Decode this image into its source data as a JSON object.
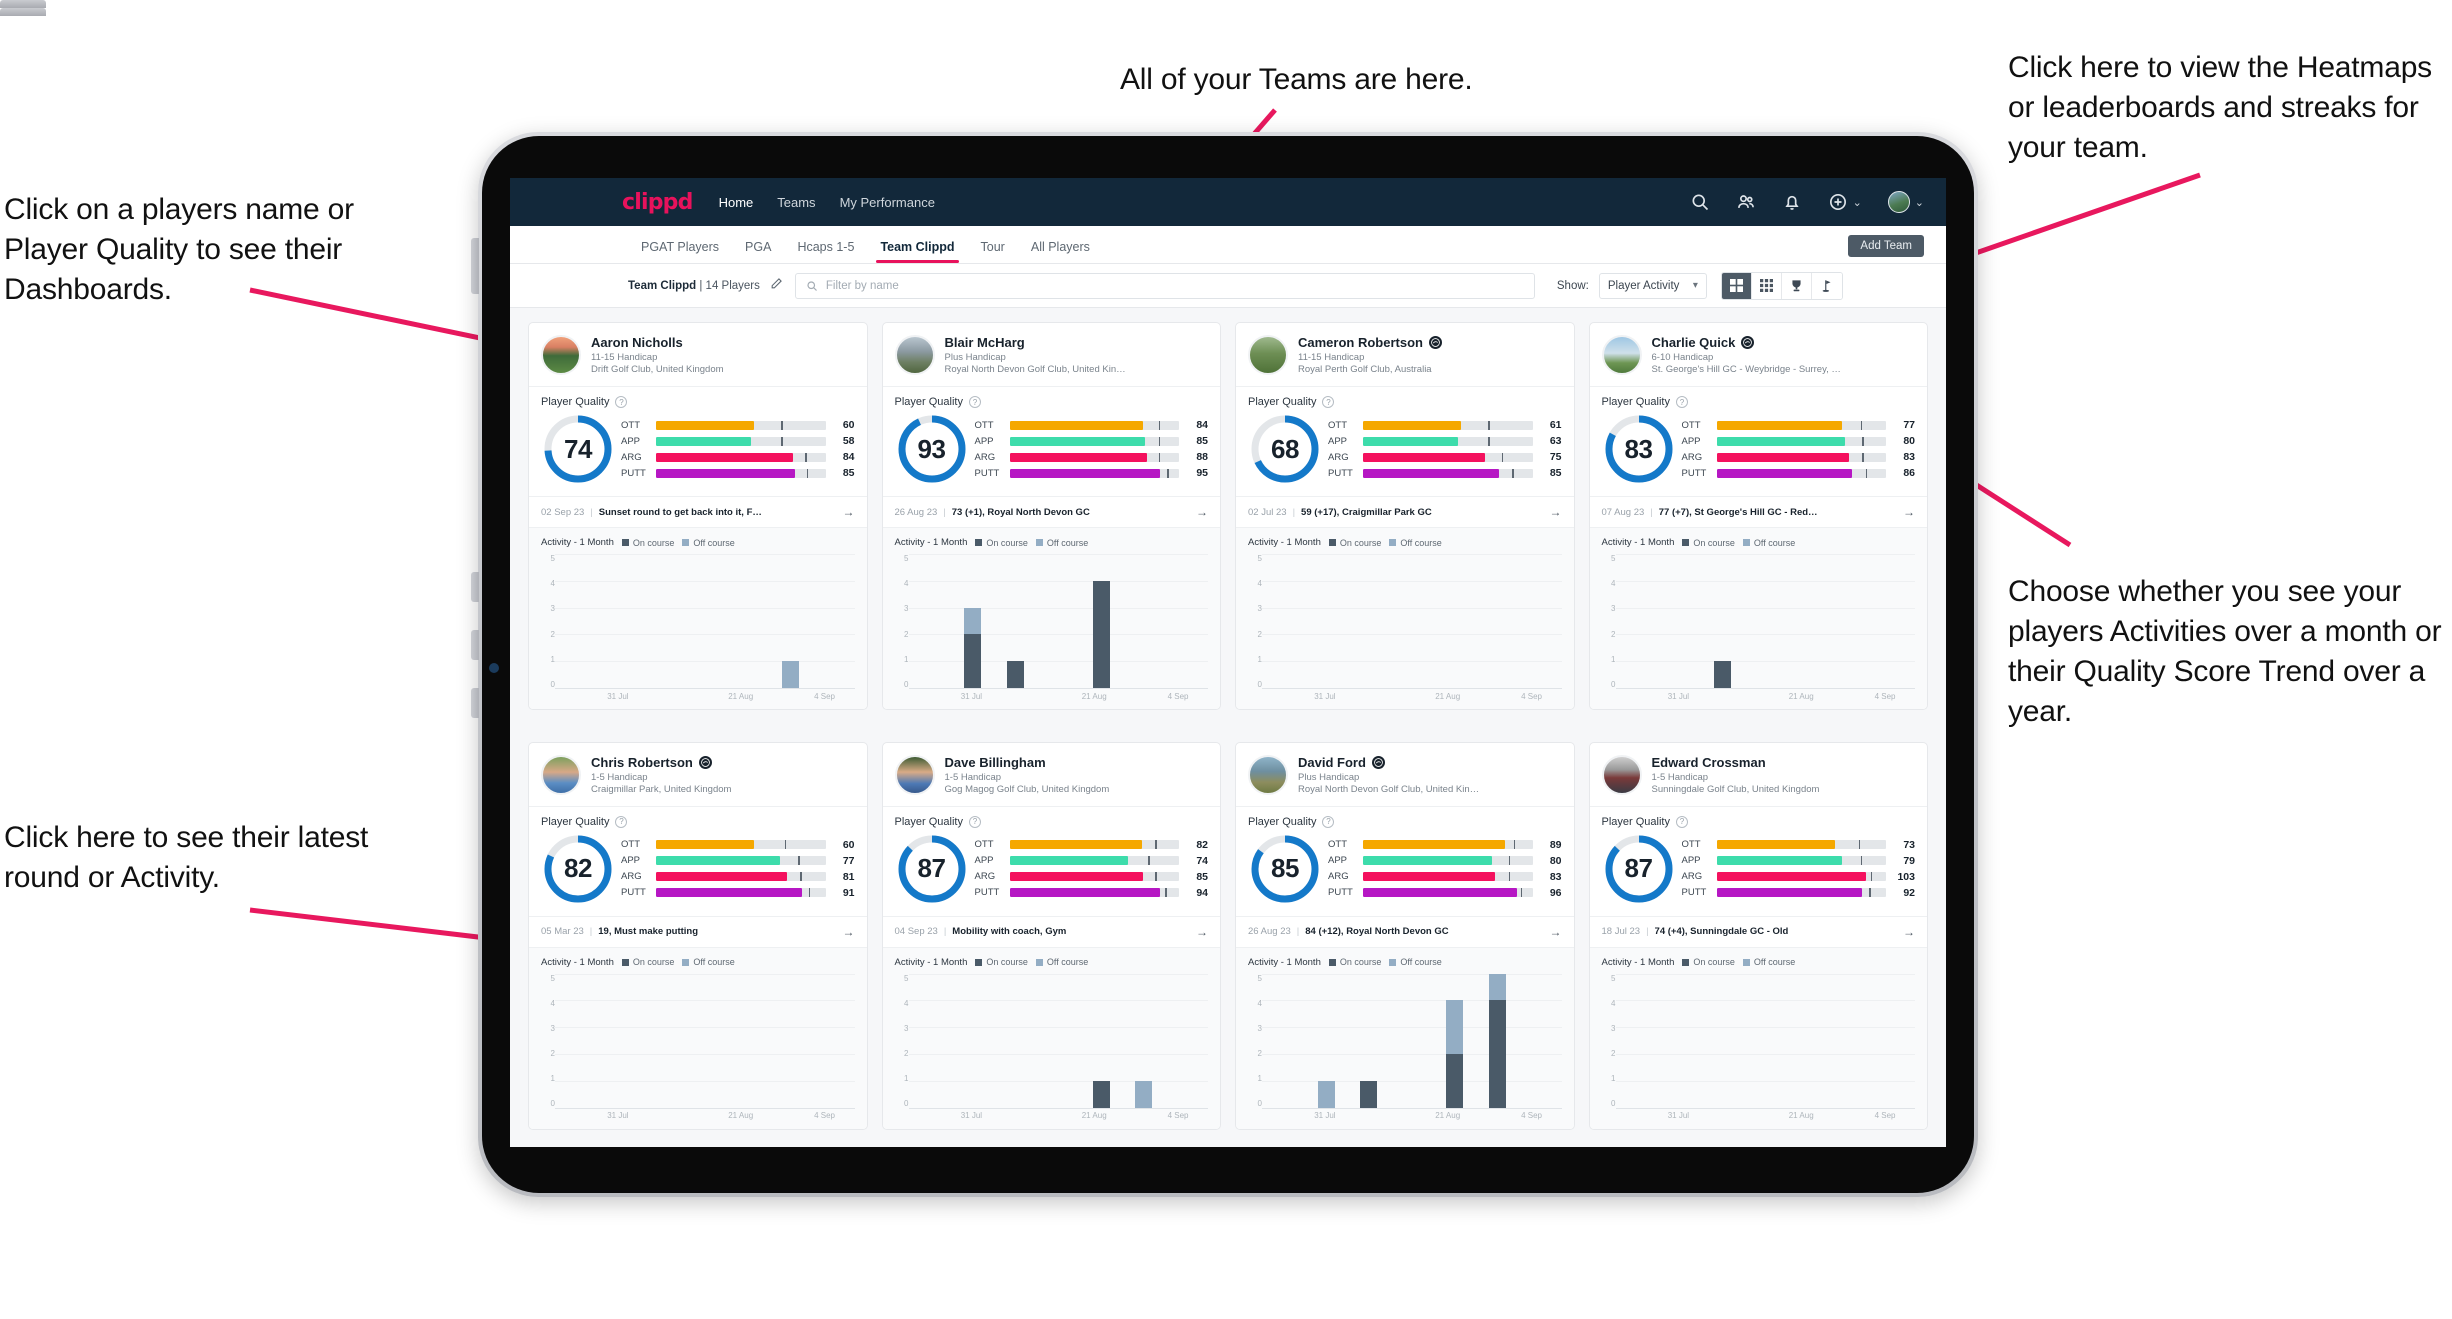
{
  "annotations": [
    {
      "id": "players-name",
      "text": "Click on a players name or Player Quality to see their Dashboards."
    },
    {
      "id": "teams",
      "text": "All of your Teams are here."
    },
    {
      "id": "heatmaps",
      "text": "Click here to view the Heatmaps or leaderboards and streaks for your team."
    },
    {
      "id": "show-select",
      "text": "Choose whether you see your players Activities over a month or their Quality Score Trend over a year."
    },
    {
      "id": "latest-round",
      "text": "Click here to see their latest round or Activity."
    }
  ],
  "navbar": {
    "brand": "clippd",
    "links": [
      {
        "label": "Home",
        "active": true
      },
      {
        "label": "Teams",
        "active": false
      },
      {
        "label": "My Performance",
        "active": false
      }
    ],
    "icons": [
      "search-icon",
      "people-icon",
      "bell-icon",
      "plus-circle-icon",
      "avatar"
    ],
    "caret": "⌄"
  },
  "tabs": [
    {
      "label": "PGAT Players",
      "active": false
    },
    {
      "label": "PGA",
      "active": false
    },
    {
      "label": "Hcaps 1-5",
      "active": false
    },
    {
      "label": "Team Clippd",
      "active": true
    },
    {
      "label": "Tour",
      "active": false
    },
    {
      "label": "All Players",
      "active": false
    }
  ],
  "add_team_label": "Add Team",
  "toolbar": {
    "team_name": "Team Clippd",
    "team_count": "| 14 Players",
    "edit_icon": "pencil-icon",
    "search_placeholder": "Filter by name",
    "search_value": "",
    "show_label": "Show:",
    "show_value": "Player Activity",
    "view_modes": [
      {
        "icon": "grid-large-icon",
        "active": true
      },
      {
        "icon": "grid-dense-icon",
        "active": false
      },
      {
        "icon": "trophy-icon",
        "active": false
      },
      {
        "icon": "flag-icon",
        "active": false
      }
    ]
  },
  "card_labels": {
    "player_quality": "Player Quality",
    "activity": "Activity - 1 Month",
    "legend_on": "On course",
    "legend_off": "Off course",
    "arrow": "→"
  },
  "metric_colors": {
    "OTT": "#f5a800",
    "APP": "#3ddcab",
    "ARG": "#f4115e",
    "PUTT": "#b617c4",
    "gauge": "#1479c9",
    "track": "#e3e6e9"
  },
  "chart_axis": {
    "yticks": [
      "5",
      "4",
      "3",
      "2",
      "1",
      "0"
    ],
    "xticks": [
      "31 Jul",
      "21 Aug",
      "4 Sep"
    ],
    "ymax": 5
  },
  "players": [
    {
      "name": "Aaron Nicholls",
      "verified": false,
      "handicap": "11-15 Handicap",
      "club": "Drift Golf Club, United Kingdom",
      "quality": 74,
      "metrics": [
        {
          "label": "OTT",
          "value": 60,
          "pct": 58,
          "tick": 74
        },
        {
          "label": "APP",
          "value": 58,
          "pct": 56,
          "tick": 74
        },
        {
          "label": "ARG",
          "value": 84,
          "pct": 81,
          "tick": 88
        },
        {
          "label": "PUTT",
          "value": 85,
          "pct": 82,
          "tick": 89
        }
      ],
      "round_date": "02 Sep 23",
      "round_text": "Sunset round to get back into it, F…",
      "activity": [
        {
          "on": 0,
          "off": 0
        },
        {
          "on": 0,
          "off": 0
        },
        {
          "on": 0,
          "off": 0
        },
        {
          "on": 0,
          "off": 0
        },
        {
          "on": 0,
          "off": 0
        },
        {
          "on": 0,
          "off": 1
        },
        {
          "on": 0,
          "off": 0
        }
      ],
      "avatar_style": "scene-sunset"
    },
    {
      "name": "Blair McHarg",
      "verified": false,
      "handicap": "Plus Handicap",
      "club": "Royal North Devon Golf Club, United Kin…",
      "quality": 93,
      "metrics": [
        {
          "label": "OTT",
          "value": 84,
          "pct": 79,
          "tick": 88
        },
        {
          "label": "APP",
          "value": 85,
          "pct": 80,
          "tick": 88
        },
        {
          "label": "ARG",
          "value": 88,
          "pct": 81,
          "tick": 88
        },
        {
          "label": "PUTT",
          "value": 95,
          "pct": 89,
          "tick": 93
        }
      ],
      "round_date": "26 Aug 23",
      "round_text": "73 (+1), Royal North Devon GC",
      "activity": [
        {
          "on": 0,
          "off": 0
        },
        {
          "on": 2,
          "off": 1
        },
        {
          "on": 1,
          "off": 0
        },
        {
          "on": 0,
          "off": 0
        },
        {
          "on": 4,
          "off": 0
        },
        {
          "on": 0,
          "off": 0
        },
        {
          "on": 0,
          "off": 0
        }
      ],
      "avatar_style": "scene-links"
    },
    {
      "name": "Cameron Robertson",
      "verified": true,
      "handicap": "11-15 Handicap",
      "club": "Royal Perth Golf Club, Australia",
      "quality": 68,
      "metrics": [
        {
          "label": "OTT",
          "value": 61,
          "pct": 58,
          "tick": 74
        },
        {
          "label": "APP",
          "value": 63,
          "pct": 56,
          "tick": 74
        },
        {
          "label": "ARG",
          "value": 75,
          "pct": 72,
          "tick": 82
        },
        {
          "label": "PUTT",
          "value": 85,
          "pct": 80,
          "tick": 88
        }
      ],
      "round_date": "02 Jul 23",
      "round_text": "59 (+17), Craigmillar Park GC",
      "activity": [
        {
          "on": 0,
          "off": 0
        },
        {
          "on": 0,
          "off": 0
        },
        {
          "on": 0,
          "off": 0
        },
        {
          "on": 0,
          "off": 0
        },
        {
          "on": 0,
          "off": 0
        },
        {
          "on": 0,
          "off": 0
        },
        {
          "on": 0,
          "off": 0
        }
      ],
      "avatar_style": "scene-fairway"
    },
    {
      "name": "Charlie Quick",
      "verified": true,
      "handicap": "6-10 Handicap",
      "club": "St. George's Hill GC - Weybridge - Surrey, …",
      "quality": 83,
      "metrics": [
        {
          "label": "OTT",
          "value": 77,
          "pct": 74,
          "tick": 85
        },
        {
          "label": "APP",
          "value": 80,
          "pct": 76,
          "tick": 86
        },
        {
          "label": "ARG",
          "value": 83,
          "pct": 78,
          "tick": 86
        },
        {
          "label": "PUTT",
          "value": 86,
          "pct": 80,
          "tick": 88
        }
      ],
      "round_date": "07 Aug 23",
      "round_text": "77 (+7), St George's Hill GC - Red…",
      "activity": [
        {
          "on": 0,
          "off": 0
        },
        {
          "on": 0,
          "off": 0
        },
        {
          "on": 1,
          "off": 0
        },
        {
          "on": 0,
          "off": 0
        },
        {
          "on": 0,
          "off": 0
        },
        {
          "on": 0,
          "off": 0
        },
        {
          "on": 0,
          "off": 0
        }
      ],
      "avatar_style": "scene-sky"
    },
    {
      "name": "Chris Robertson",
      "verified": true,
      "handicap": "1-5 Handicap",
      "club": "Craigmillar Park, United Kingdom",
      "quality": 82,
      "metrics": [
        {
          "label": "OTT",
          "value": 60,
          "pct": 58,
          "tick": 76
        },
        {
          "label": "APP",
          "value": 77,
          "pct": 73,
          "tick": 84
        },
        {
          "label": "ARG",
          "value": 81,
          "pct": 77,
          "tick": 85
        },
        {
          "label": "PUTT",
          "value": 91,
          "pct": 86,
          "tick": 90
        }
      ],
      "round_date": "05 Mar 23",
      "round_text": "19, Must make putting",
      "activity": [
        {
          "on": 0,
          "off": 0
        },
        {
          "on": 0,
          "off": 0
        },
        {
          "on": 0,
          "off": 0
        },
        {
          "on": 0,
          "off": 0
        },
        {
          "on": 0,
          "off": 0
        },
        {
          "on": 0,
          "off": 0
        },
        {
          "on": 0,
          "off": 0
        }
      ],
      "avatar_style": "portrait-a"
    },
    {
      "name": "Dave Billingham",
      "verified": false,
      "handicap": "1-5 Handicap",
      "club": "Gog Magog Golf Club, United Kingdom",
      "quality": 87,
      "metrics": [
        {
          "label": "OTT",
          "value": 82,
          "pct": 78,
          "tick": 86
        },
        {
          "label": "APP",
          "value": 74,
          "pct": 70,
          "tick": 82
        },
        {
          "label": "ARG",
          "value": 85,
          "pct": 79,
          "tick": 86
        },
        {
          "label": "PUTT",
          "value": 94,
          "pct": 89,
          "tick": 92
        }
      ],
      "round_date": "04 Sep 23",
      "round_text": "Mobility with coach, Gym",
      "activity": [
        {
          "on": 0,
          "off": 0
        },
        {
          "on": 0,
          "off": 0
        },
        {
          "on": 0,
          "off": 0
        },
        {
          "on": 0,
          "off": 0
        },
        {
          "on": 1,
          "off": 0
        },
        {
          "on": 0,
          "off": 1
        },
        {
          "on": 0,
          "off": 0
        }
      ],
      "avatar_style": "portrait-b"
    },
    {
      "name": "David Ford",
      "verified": true,
      "handicap": "Plus Handicap",
      "club": "Royal North Devon Golf Club, United Kin…",
      "quality": 85,
      "metrics": [
        {
          "label": "OTT",
          "value": 89,
          "pct": 84,
          "tick": 89
        },
        {
          "label": "APP",
          "value": 80,
          "pct": 76,
          "tick": 86
        },
        {
          "label": "ARG",
          "value": 83,
          "pct": 78,
          "tick": 86
        },
        {
          "label": "PUTT",
          "value": 96,
          "pct": 91,
          "tick": 93
        }
      ],
      "round_date": "26 Aug 23",
      "round_text": "84 (+12), Royal North Devon GC",
      "activity": [
        {
          "on": 0,
          "off": 0
        },
        {
          "on": 0,
          "off": 1
        },
        {
          "on": 1,
          "off": 0
        },
        {
          "on": 0,
          "off": 0
        },
        {
          "on": 2,
          "off": 2
        },
        {
          "on": 4,
          "off": 1
        },
        {
          "on": 0,
          "off": 0
        }
      ],
      "avatar_style": "scene-coast"
    },
    {
      "name": "Edward Crossman",
      "verified": false,
      "handicap": "1-5 Handicap",
      "club": "Sunningdale Golf Club, United Kingdom",
      "quality": 87,
      "metrics": [
        {
          "label": "OTT",
          "value": 73,
          "pct": 70,
          "tick": 84
        },
        {
          "label": "APP",
          "value": 79,
          "pct": 74,
          "tick": 85
        },
        {
          "label": "ARG",
          "value": 103,
          "pct": 88,
          "tick": 91
        },
        {
          "label": "PUTT",
          "value": 92,
          "pct": 86,
          "tick": 90
        }
      ],
      "round_date": "18 Jul 23",
      "round_text": "74 (+4), Sunningdale GC - Old",
      "activity": [
        {
          "on": 0,
          "off": 0
        },
        {
          "on": 0,
          "off": 0
        },
        {
          "on": 0,
          "off": 0
        },
        {
          "on": 0,
          "off": 0
        },
        {
          "on": 0,
          "off": 0
        },
        {
          "on": 0,
          "off": 0
        },
        {
          "on": 0,
          "off": 0
        }
      ],
      "avatar_style": "portrait-c"
    }
  ]
}
